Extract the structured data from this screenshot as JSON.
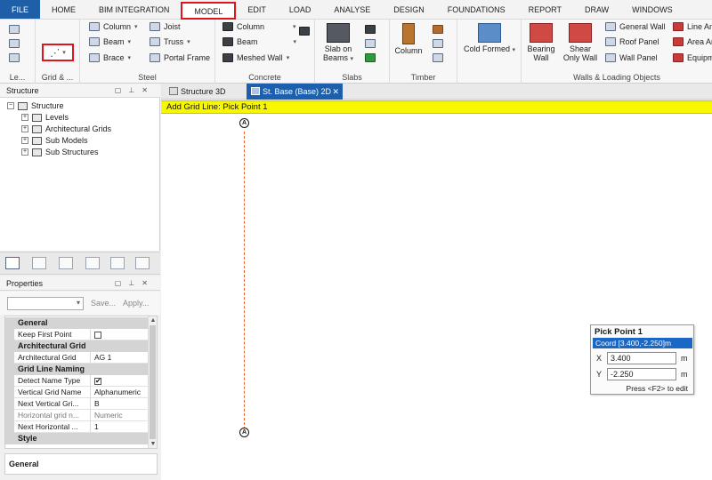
{
  "menu": {
    "file": "FILE",
    "items": [
      "HOME",
      "BIM INTEGRATION",
      "MODEL",
      "EDIT",
      "LOAD",
      "ANALYSE",
      "DESIGN",
      "FOUNDATIONS",
      "REPORT",
      "DRAW",
      "WINDOWS"
    ],
    "active": "MODEL"
  },
  "ribbon": {
    "groups": {
      "levels": "Le...",
      "grid": "Grid & ...",
      "steel": "Steel",
      "concrete": "Concrete",
      "slabs": "Slabs",
      "timber": "Timber",
      "walls": "Walls & Loading Objects"
    },
    "steel": {
      "column": "Column",
      "beam": "Beam",
      "brace": "Brace",
      "joist": "Joist",
      "truss": "Truss",
      "portal_frame": "Portal Frame"
    },
    "concrete": {
      "column": "Column",
      "beam": "Beam",
      "meshed_wall": "Meshed Wall"
    },
    "slabs": {
      "slab_on_beams_1": "Slab on",
      "slab_on_beams_2": "Beams"
    },
    "timber": {
      "column": "Column"
    },
    "cold_formed": "Cold Formed",
    "walls": {
      "bearing_1": "Bearing",
      "bearing_2": "Wall",
      "shear_1": "Shear",
      "shear_2": "Only Wall",
      "general_wall": "General Wall",
      "roof_panel": "Roof Panel",
      "wall_panel": "Wall Panel",
      "line_an": "Line An",
      "area_an": "Area An",
      "equipm": "Equipm"
    }
  },
  "structure_panel": {
    "title": "Structure",
    "root": "Structure",
    "children": [
      "Levels",
      "Architectural Grids",
      "Sub Models",
      "Sub Structures"
    ]
  },
  "properties_panel": {
    "title": "Properties",
    "save": "Save...",
    "apply": "Apply...",
    "rows": [
      {
        "type": "category",
        "label": "General"
      },
      {
        "type": "prop",
        "key": "Keep First Point",
        "value": "",
        "check": false
      },
      {
        "type": "category",
        "label": "Architectural Grid"
      },
      {
        "type": "prop",
        "key": "Architectural Grid",
        "value": "AG 1"
      },
      {
        "type": "category",
        "label": "Grid Line Naming"
      },
      {
        "type": "prop",
        "key": "Detect Name Type",
        "value": "",
        "check": true
      },
      {
        "type": "prop",
        "key": "Vertical Grid Name",
        "value": "Alphanumeric"
      },
      {
        "type": "prop",
        "key": "Next Vertical Gri...",
        "value": "B"
      },
      {
        "type": "prop",
        "key": "Horizontal grid n...",
        "value": "Numeric",
        "disabled": true
      },
      {
        "type": "prop",
        "key": "Next Horizontal ...",
        "value": "1"
      },
      {
        "type": "category",
        "label": "Style"
      }
    ],
    "description": "General"
  },
  "doc_tabs": [
    {
      "label": "Structure 3D",
      "active": false
    },
    {
      "label": "St. Base (Base) 2D",
      "active": true
    }
  ],
  "canvas": {
    "prompt": "Add Grid Line: Pick Point 1",
    "bubble_label": "A"
  },
  "pick_point": {
    "title": "Pick Point 1",
    "coord": "Coord [3.400,-2.250]m",
    "x_label": "X",
    "x_value": "3.400",
    "y_label": "Y",
    "y_value": "-2.250",
    "unit": "m",
    "hint": "Press <F2> to edit"
  },
  "colors": {
    "accent": "#1b5fad",
    "highlight": "#e0151b",
    "prompt_band": "#f7f700",
    "grid_line": "#e8632c"
  }
}
